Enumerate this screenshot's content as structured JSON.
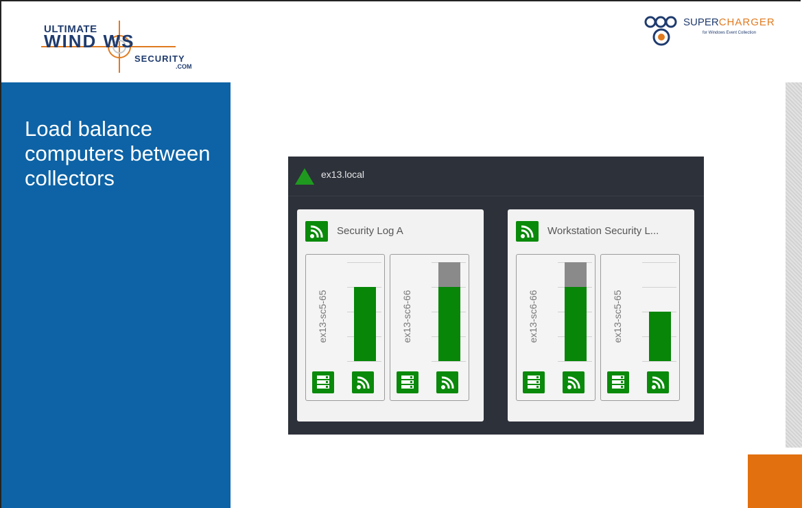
{
  "branding": {
    "left_logo": {
      "line1": "ULTIMATE",
      "line2": "WIND  WS",
      "line3": "SECURITY",
      "line4": ".COM"
    },
    "right_logo": {
      "title_a": "S",
      "title_b": "UPER",
      "title_c": "CHARGER",
      "subtitle": "for Windows Event Collection"
    }
  },
  "slide": {
    "title": "Load balance computers between collectors"
  },
  "dashboard": {
    "domain": "ex13.local",
    "colors": {
      "background": "#2d313a",
      "accent": "#0a8a0a",
      "bar": "#078607",
      "bar_overflow": "#8a8a8a",
      "status_ok": "#1f9a1f"
    },
    "subscriptions": [
      {
        "title": "Security Log A",
        "icon": "rss-feed-icon",
        "collectors": [
          {
            "name": "ex13-sc5-65",
            "load": 0.75,
            "overflow": 0.0
          },
          {
            "name": "ex13-sc6-66",
            "load": 0.75,
            "overflow": 0.25
          }
        ]
      },
      {
        "title": "Workstation Security L...",
        "icon": "rss-feed-icon",
        "collectors": [
          {
            "name": "ex13-sc6-66",
            "load": 0.75,
            "overflow": 0.25
          },
          {
            "name": "ex13-sc5-65",
            "load": 0.5,
            "overflow": 0.0
          }
        ]
      }
    ]
  }
}
